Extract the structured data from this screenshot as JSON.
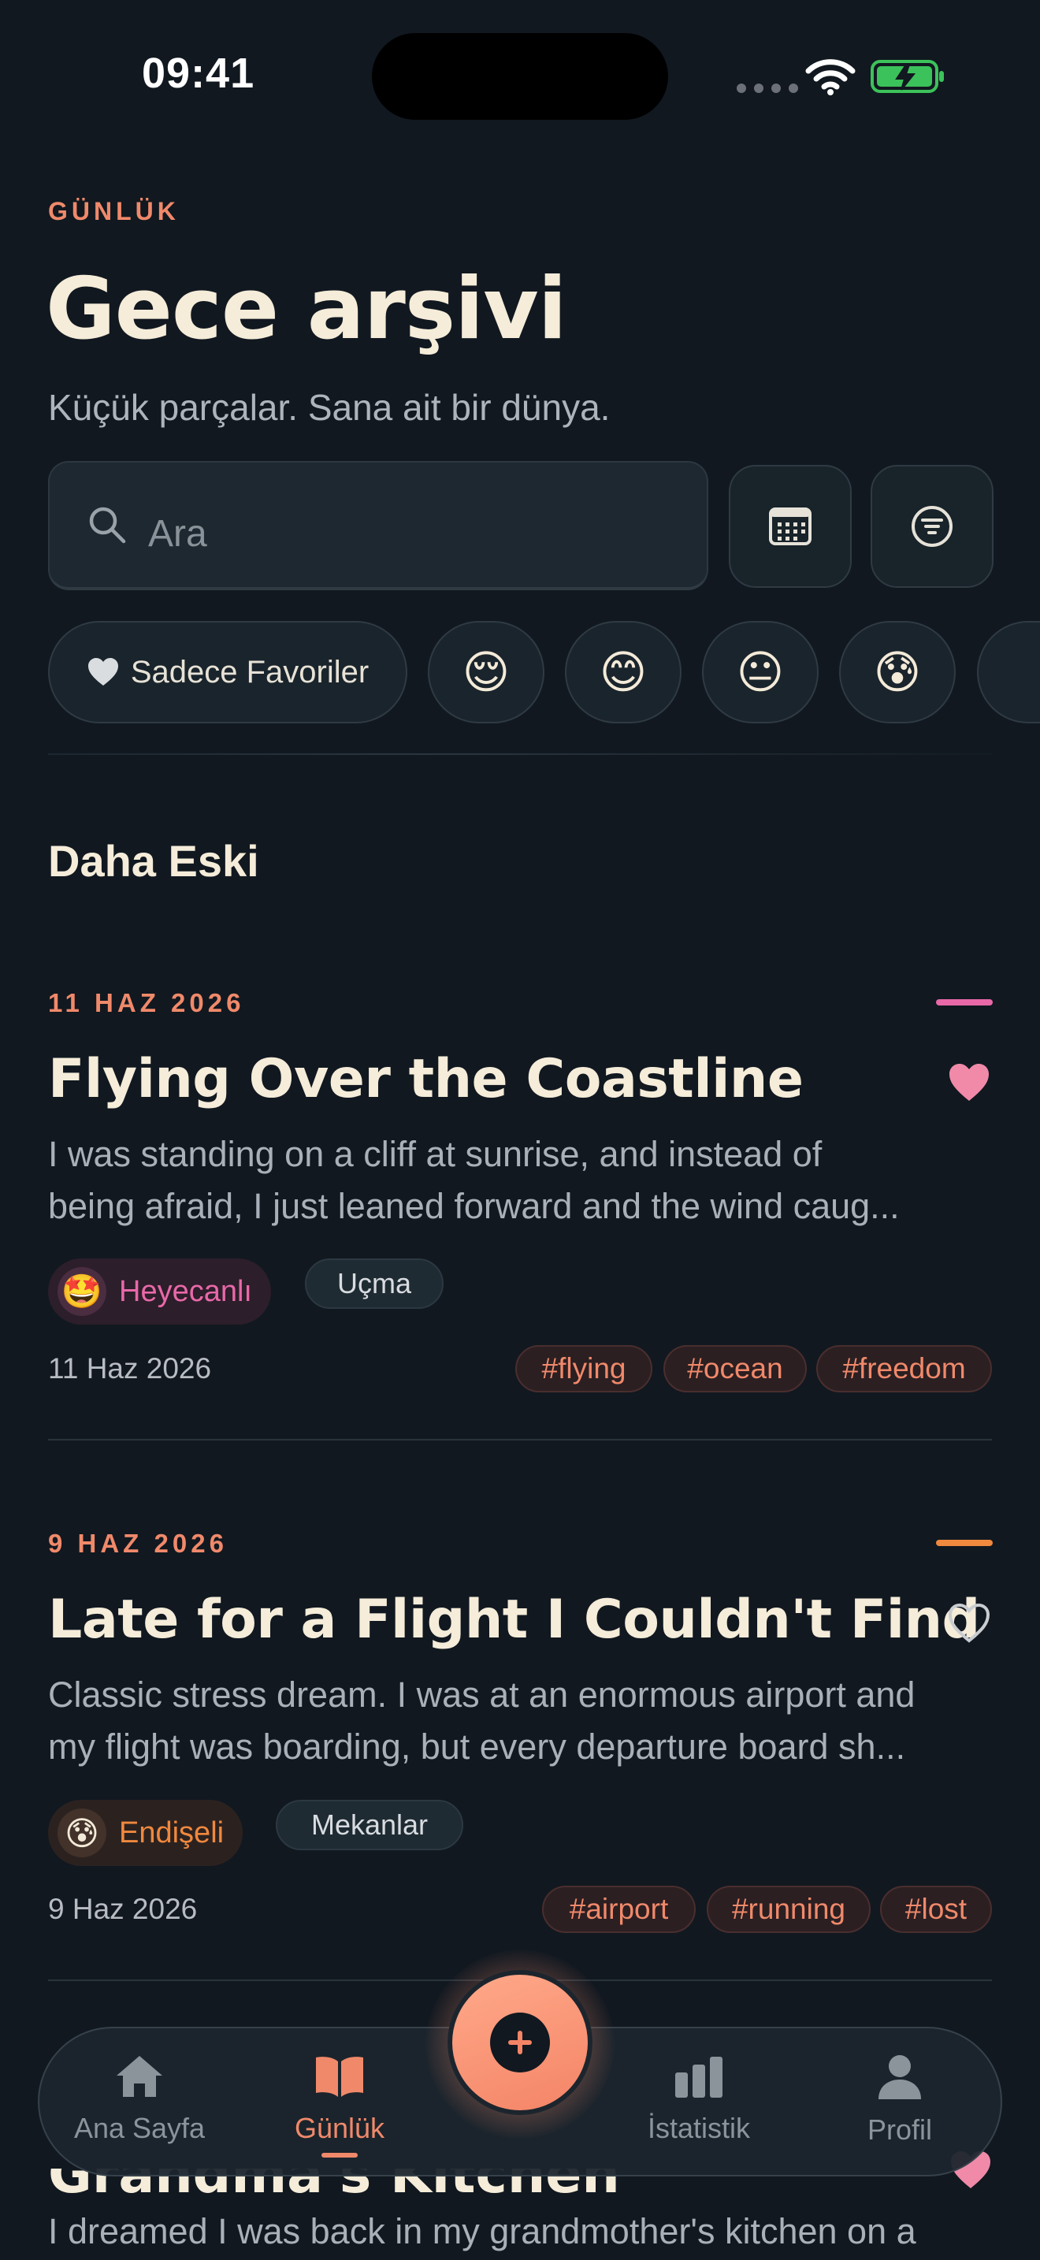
{
  "status_bar": {
    "time": "09:41"
  },
  "header": {
    "kicker": "GÜNLÜK",
    "title": "Gece arşivi",
    "subtitle": "Küçük parçalar. Sana ait bir dünya."
  },
  "search": {
    "placeholder": "Ara",
    "icon": "search-icon"
  },
  "toolbar": {
    "calendar_icon": "calendar-icon",
    "filter_icon": "filter-icon"
  },
  "filters": {
    "favorites_label": "Sadece Favoriler",
    "moods": [
      "😌",
      "😊",
      "😐",
      "😰"
    ]
  },
  "section_title": "Daha Eski",
  "entries": [
    {
      "date_kicker": "11 HAZ 2026",
      "title": "Flying Over the Coastline",
      "body_line1": "I was standing on a cliff at sunrise, and instead of",
      "body_line2": "being afraid, I just leaned forward and the wind caug...",
      "favorite": true,
      "mood_emoji": "🤩",
      "mood_label": "Heyecanlı",
      "category": "Uçma",
      "date": "11 Haz 2026",
      "tags": [
        "#flying",
        "#ocean",
        "#freedom"
      ],
      "accent_color": "#e868a8"
    },
    {
      "date_kicker": "9 HAZ 2026",
      "title": "Late for a Flight I Couldn't Find",
      "body_line1": "Classic stress dream. I was at an enormous airport and",
      "body_line2": "my flight was boarding, but every departure board sh...",
      "favorite": false,
      "mood_emoji": "😰",
      "mood_label": "Endişeli",
      "category": "Mekanlar",
      "date": "9 Haz 2026",
      "tags": [
        "#airport",
        "#running",
        "#lost"
      ],
      "accent_color": "#f0883e"
    },
    {
      "title": "Grandma's Kitchen",
      "body_line1": "I dreamed I was back in my grandmother's kitchen on a"
    }
  ],
  "nav": {
    "items": [
      {
        "label": "Ana Sayfa",
        "icon": "home-icon"
      },
      {
        "label": "Günlük",
        "icon": "book-icon"
      },
      {
        "label": "İstatistik",
        "icon": "chart-icon"
      },
      {
        "label": "Profil",
        "icon": "profile-icon"
      }
    ],
    "active_index": 1,
    "add_icon": "plus-icon"
  },
  "colors": {
    "background": "#111820",
    "accent": "#f0896a",
    "excited": "#e868a8",
    "anxious": "#f0883e"
  }
}
